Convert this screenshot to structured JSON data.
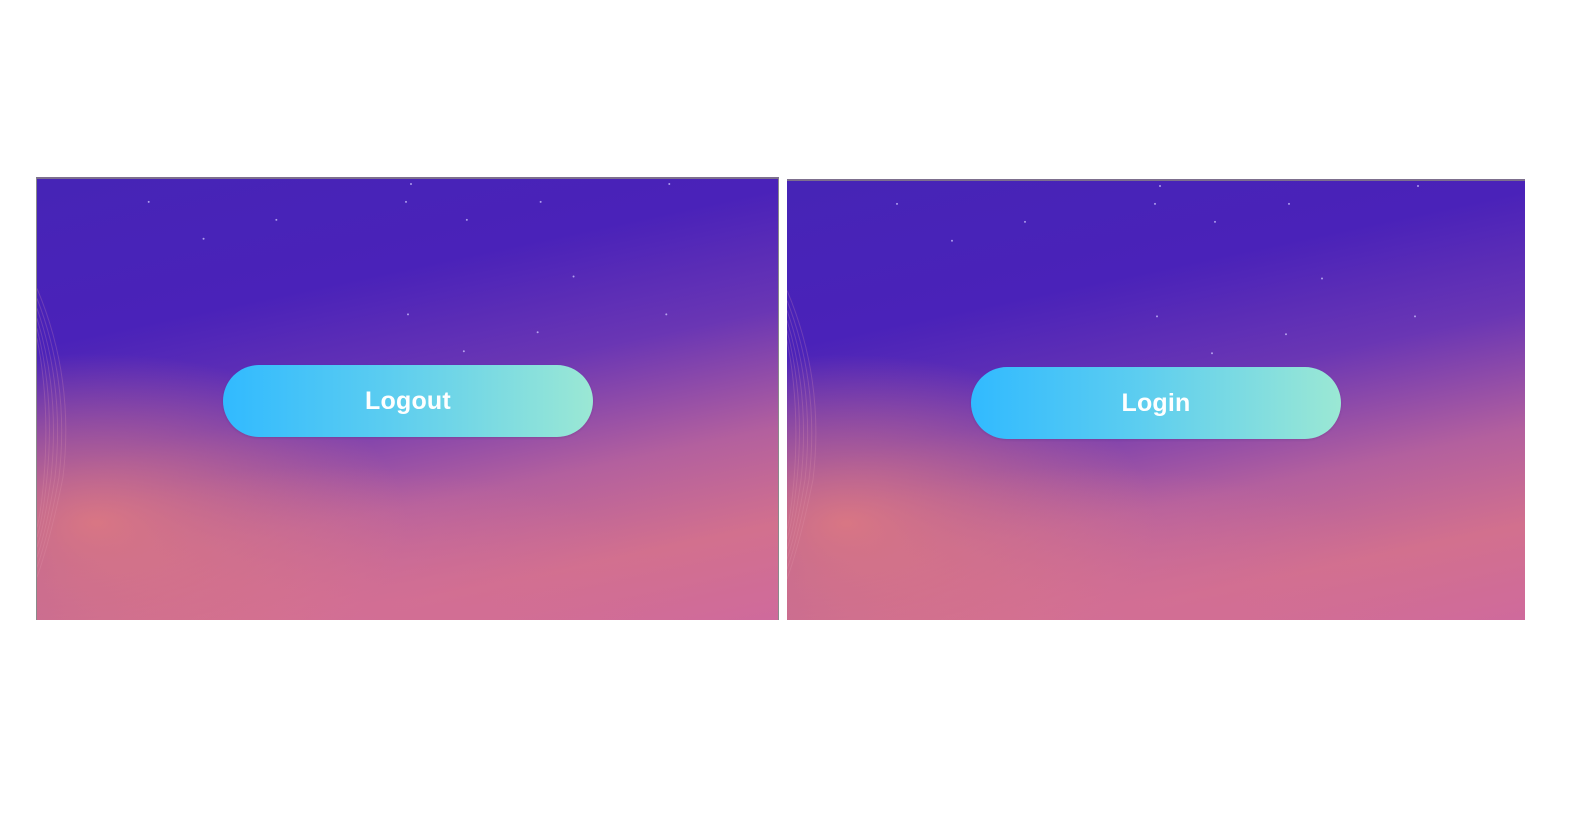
{
  "panels": [
    {
      "id": "left",
      "button": {
        "label": "Logout"
      }
    },
    {
      "id": "right",
      "button": {
        "label": "Login"
      }
    }
  ],
  "colors": {
    "page_background": "#ffffff",
    "sky_top": "#4624b6",
    "sky_bottom": "#cf6a9c",
    "button_gradient_start": "#31baff",
    "button_gradient_end": "#9be8d4",
    "button_text": "#ffffff"
  },
  "icons": [
    "star-dot",
    "contour-waves"
  ]
}
